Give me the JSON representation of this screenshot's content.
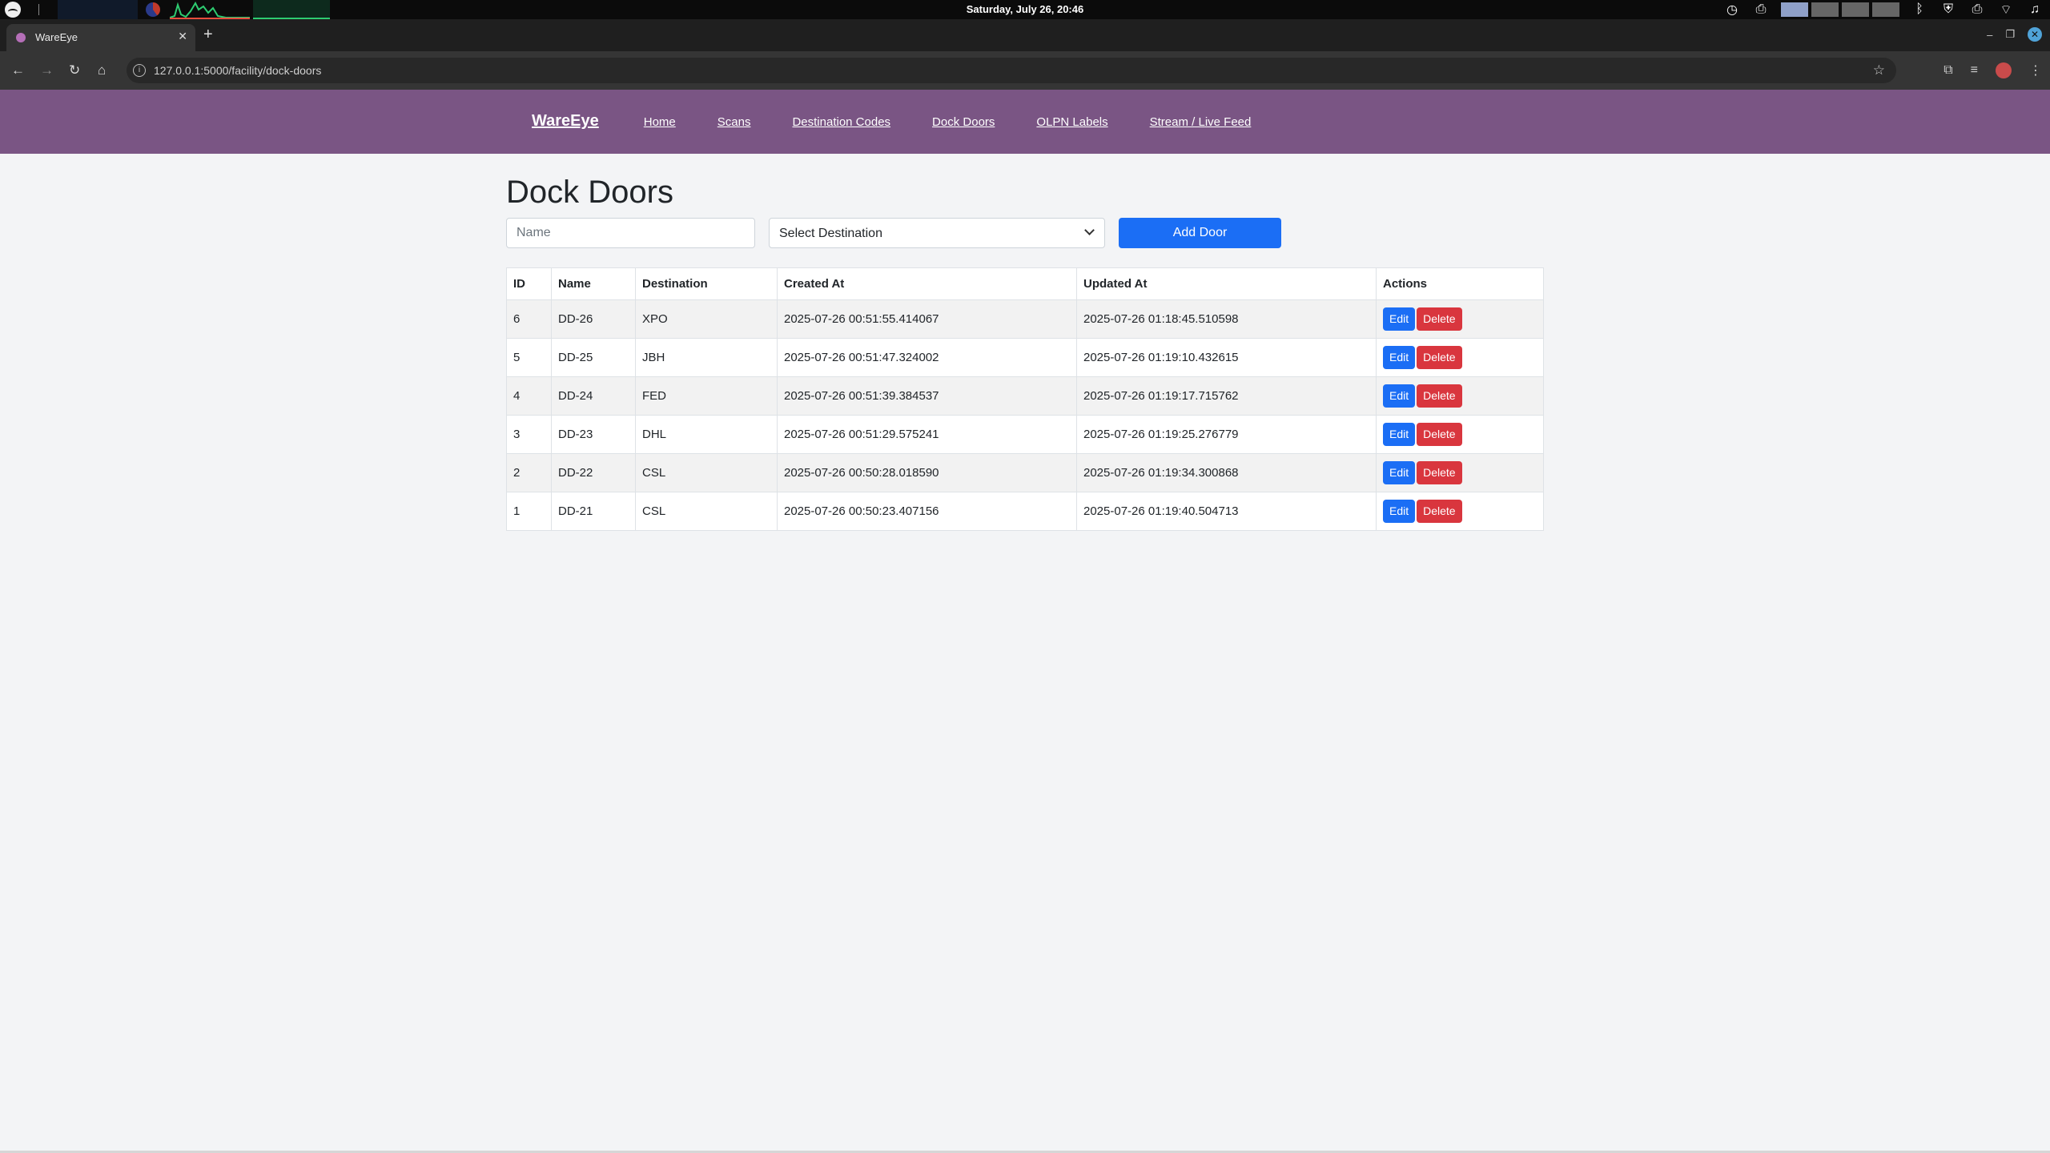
{
  "os": {
    "clock": "Saturday, July 26, 20:46"
  },
  "browser": {
    "tab_title": "WareEye",
    "url": "127.0.0.1:5000/facility/dock-doors"
  },
  "site": {
    "brand": "WareEye",
    "nav": [
      "Home",
      "Scans",
      "Destination Codes",
      "Dock Doors",
      "OLPN Labels",
      "Stream / Live Feed"
    ]
  },
  "page": {
    "title": "Dock Doors",
    "name_placeholder": "Name",
    "select_value": "Select Destination",
    "add_button": "Add Door"
  },
  "table": {
    "headers": [
      "ID",
      "Name",
      "Destination",
      "Created At",
      "Updated At",
      "Actions"
    ],
    "edit_label": "Edit",
    "delete_label": "Delete",
    "rows": [
      {
        "id": "6",
        "name": "DD-26",
        "destination": "XPO",
        "created": "2025-07-26 00:51:55.414067",
        "updated": "2025-07-26 01:18:45.510598"
      },
      {
        "id": "5",
        "name": "DD-25",
        "destination": "JBH",
        "created": "2025-07-26 00:51:47.324002",
        "updated": "2025-07-26 01:19:10.432615"
      },
      {
        "id": "4",
        "name": "DD-24",
        "destination": "FED",
        "created": "2025-07-26 00:51:39.384537",
        "updated": "2025-07-26 01:19:17.715762"
      },
      {
        "id": "3",
        "name": "DD-23",
        "destination": "DHL",
        "created": "2025-07-26 00:51:29.575241",
        "updated": "2025-07-26 01:19:25.276779"
      },
      {
        "id": "2",
        "name": "DD-22",
        "destination": "CSL",
        "created": "2025-07-26 00:50:28.018590",
        "updated": "2025-07-26 01:19:34.300868"
      },
      {
        "id": "1",
        "name": "DD-21",
        "destination": "CSL",
        "created": "2025-07-26 00:50:23.407156",
        "updated": "2025-07-26 01:19:40.504713"
      }
    ]
  },
  "colors": {
    "navbar": "#7a5584",
    "primary": "#1b6ef5",
    "danger": "#d9363e",
    "page_bg": "#f3f4f6"
  }
}
